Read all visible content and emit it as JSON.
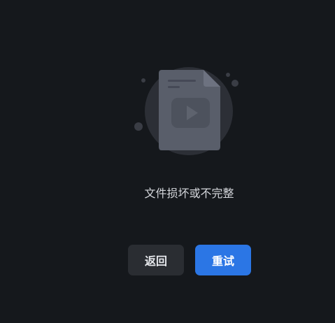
{
  "status": {
    "message": "文件损坏或不完整"
  },
  "actions": {
    "back_label": "返回",
    "retry_label": "重试"
  },
  "illustration": {
    "icon": "corrupted-video-file-icon"
  },
  "colors": {
    "background": "#15181c",
    "primary": "#2b76e5",
    "secondary_button": "#2a2d32"
  }
}
